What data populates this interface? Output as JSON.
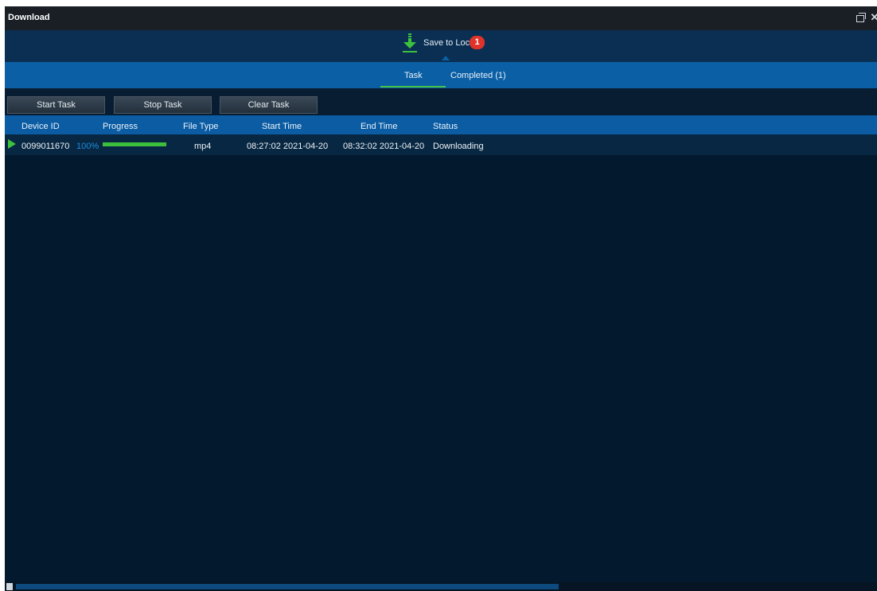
{
  "window": {
    "title": "Download"
  },
  "save_bar": {
    "label": "Save to Local",
    "badge_count": "1"
  },
  "tabs": [
    {
      "label": "Task",
      "active": true
    },
    {
      "label": "Completed (1)",
      "active": false
    }
  ],
  "toolbar": {
    "start_task": "Start Task",
    "stop_task": "Stop Task",
    "clear_task": "Clear Task"
  },
  "table": {
    "columns": [
      "Device ID",
      "Progress",
      "File Type",
      "Start Time",
      "End Time",
      "Status"
    ],
    "rows": [
      {
        "device_id": "0099011670",
        "progress_text": "100%",
        "progress_value": 1.0,
        "file_type": "mp4",
        "start_time": "08:27:02 2021-04-20",
        "end_time": "08:32:02 2021-04-20",
        "status": "Downloading"
      }
    ]
  },
  "colors": {
    "background": "#031a2e",
    "accent": "#0b5fa5",
    "progress": "#3cbf3c",
    "badge": "#e0332a"
  },
  "icons": {
    "download": "download-arrow-icon",
    "play": "play-icon",
    "restore": "restore-icon",
    "close": "close-icon"
  }
}
